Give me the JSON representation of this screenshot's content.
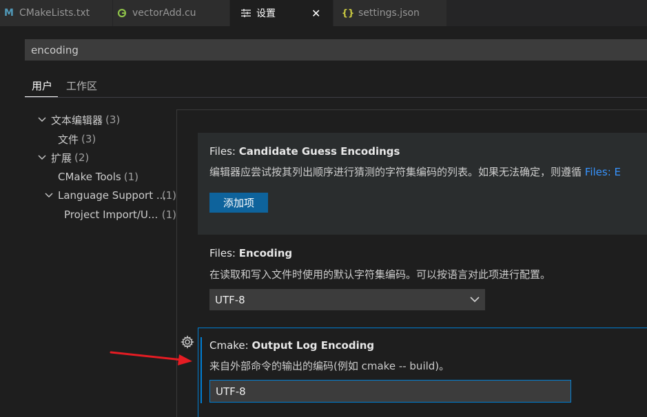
{
  "tabs": [
    {
      "icon": "M",
      "icon_color": "#519aba",
      "label": "CMakeLists.txt",
      "active": false
    },
    {
      "icon": "C",
      "icon_color": "#8dc149",
      "label": "vectorAdd.cu",
      "active": false
    },
    {
      "icon": "≡",
      "icon_color": "#cccccc",
      "label": "设置",
      "active": true,
      "close": "✕"
    },
    {
      "icon": "{}",
      "icon_color": "#cbcb41",
      "label": "settings.json",
      "active": false
    }
  ],
  "search": {
    "value": "encoding"
  },
  "scopes": {
    "user": "用户",
    "workspace": "工作区"
  },
  "toc": {
    "text_editor": {
      "label": "文本编辑器",
      "count": "(3)"
    },
    "files": {
      "label": "文件",
      "count": "(3)"
    },
    "extensions": {
      "label": "扩展",
      "count": "(2)"
    },
    "cmake_tools": {
      "label": "CMake Tools",
      "count": "(1)"
    },
    "language_support": {
      "label": "Language Support ...",
      "count": "(1)"
    },
    "project_import": {
      "label": "Project Import/U...",
      "count": "(1)"
    }
  },
  "settings": {
    "candidate": {
      "category": "Files: ",
      "name": "Candidate Guess Encodings",
      "desc": "编辑器应尝试按其列出顺序进行猜测的字符集编码的列表。如果无法确定，则遵循 ",
      "desc_link": "Files: E",
      "button": "添加项"
    },
    "encoding": {
      "category": "Files: ",
      "name": "Encoding",
      "desc": "在读取和写入文件时使用的默认字符集编码。可以按语言对此项进行配置。",
      "value": "UTF-8"
    },
    "cmake_log": {
      "category": "Cmake: ",
      "name": "Output Log Encoding",
      "desc": "来自外部命令的输出的编码(例如 cmake -- build)。",
      "value": "UTF-8"
    }
  },
  "colors": {
    "accent": "#007fd4",
    "button": "#0e639c",
    "link": "#3794ff",
    "arrow": "#e51c23"
  }
}
